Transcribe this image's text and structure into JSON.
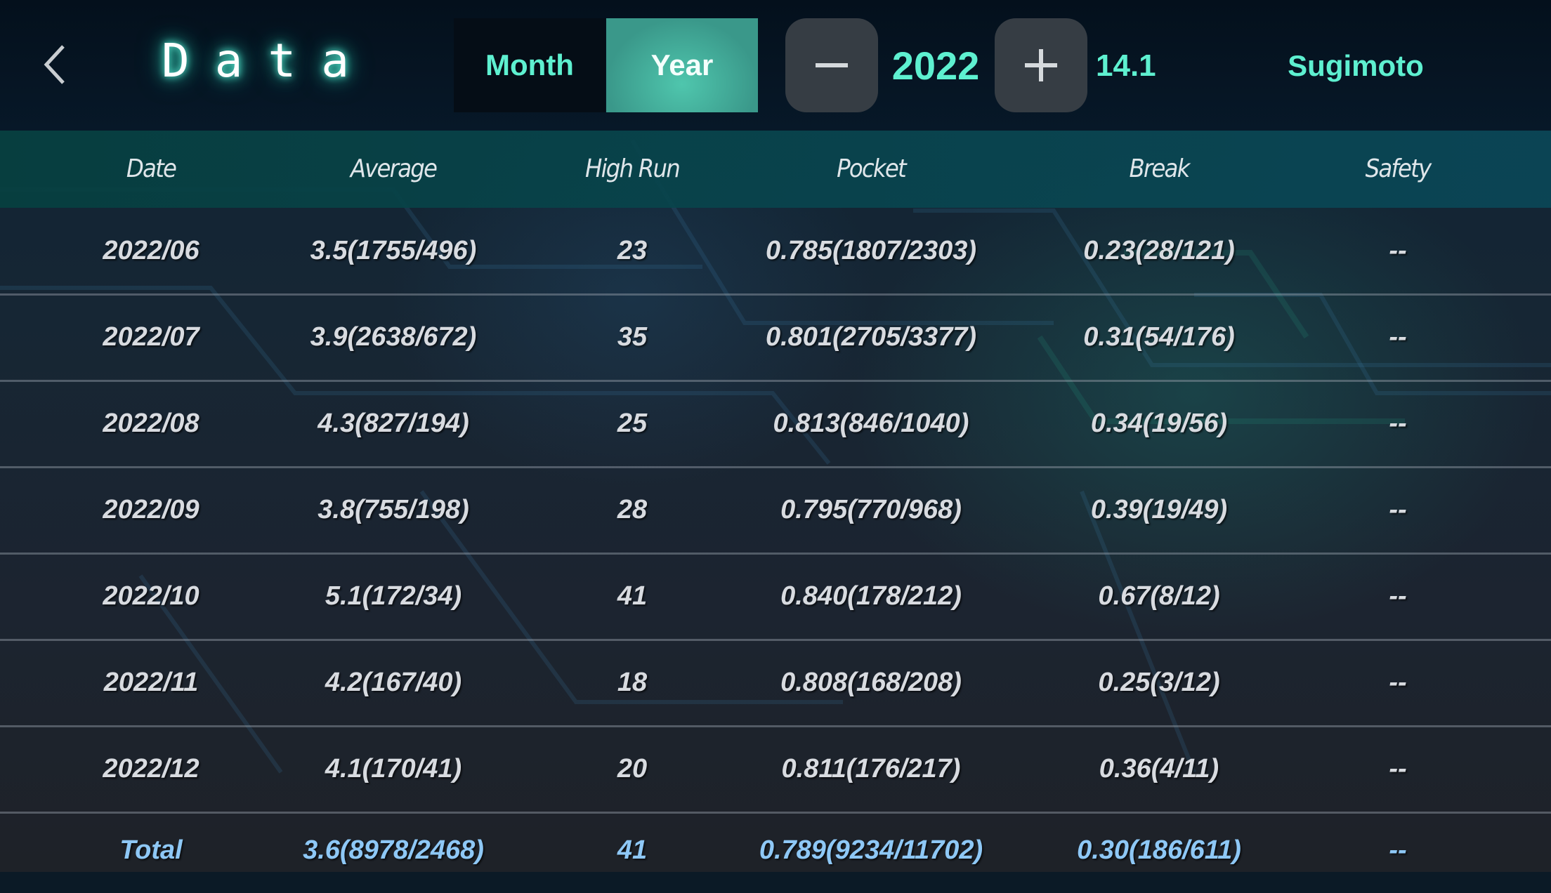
{
  "header": {
    "title": "Data",
    "tabs": [
      {
        "label": "Month",
        "selected": false
      },
      {
        "label": "Year",
        "selected": true
      }
    ],
    "year": "2022",
    "rating": "14.1",
    "player": "Sugimoto",
    "icons": {
      "back": "chevron-left-icon",
      "minus": "minus-icon",
      "plus": "plus-icon"
    }
  },
  "table": {
    "columns": [
      "Date",
      "Average",
      "High Run",
      "Pocket",
      "Break",
      "Safety"
    ],
    "rows": [
      [
        "2022/06",
        "3.5(1755/496)",
        "23",
        "0.785(1807/2303)",
        "0.23(28/121)",
        "--"
      ],
      [
        "2022/07",
        "3.9(2638/672)",
        "35",
        "0.801(2705/3377)",
        "0.31(54/176)",
        "--"
      ],
      [
        "2022/08",
        "4.3(827/194)",
        "25",
        "0.813(846/1040)",
        "0.34(19/56)",
        "--"
      ],
      [
        "2022/09",
        "3.8(755/198)",
        "28",
        "0.795(770/968)",
        "0.39(19/49)",
        "--"
      ],
      [
        "2022/10",
        "5.1(172/34)",
        "41",
        "0.840(178/212)",
        "0.67(8/12)",
        "--"
      ],
      [
        "2022/11",
        "4.2(167/40)",
        "18",
        "0.808(168/208)",
        "0.25(3/12)",
        "--"
      ],
      [
        "2022/12",
        "4.1(170/41)",
        "20",
        "0.811(176/217)",
        "0.36(4/11)",
        "--"
      ]
    ],
    "total": [
      "Total",
      "3.6(8978/2468)",
      "41",
      "0.789(9234/11702)",
      "0.30(186/611)",
      "--"
    ]
  },
  "colors": {
    "accent": "#5ef0d0",
    "selected_tab": "#3a988a",
    "total_text": "#8ec8f6",
    "cell_text": "#d8dbe0"
  }
}
